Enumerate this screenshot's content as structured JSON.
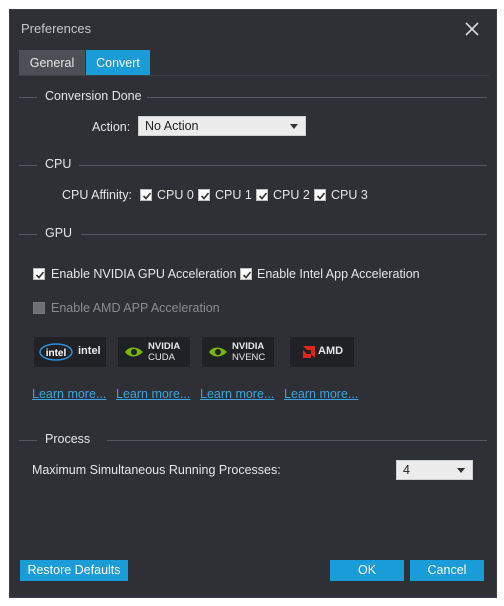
{
  "window": {
    "title": "Preferences"
  },
  "tabs": [
    {
      "label": "General",
      "active": false
    },
    {
      "label": "Convert",
      "active": true
    }
  ],
  "conversion_done": {
    "heading": "Conversion Done",
    "action_label": "Action:",
    "action_value": "No Action"
  },
  "cpu": {
    "heading": "CPU",
    "affinity_label": "CPU Affinity:",
    "cores": [
      {
        "label": "CPU 0",
        "checked": true
      },
      {
        "label": "CPU 1",
        "checked": true
      },
      {
        "label": "CPU 2",
        "checked": true
      },
      {
        "label": "CPU 3",
        "checked": true
      }
    ]
  },
  "gpu": {
    "heading": "GPU",
    "options": [
      {
        "label": "Enable NVIDIA GPU Acceleration",
        "checked": true,
        "enabled": true
      },
      {
        "label": "Enable Intel App Acceleration",
        "checked": true,
        "enabled": true
      },
      {
        "label": "Enable AMD APP Acceleration",
        "checked": false,
        "enabled": false
      }
    ],
    "logos": [
      {
        "icon": "intel-logo-icon",
        "badge": "intel",
        "text": "intel"
      },
      {
        "icon": "nvidia-cuda-logo-icon",
        "line1": "NVIDIA",
        "line2": "CUDA"
      },
      {
        "icon": "nvidia-nvenc-logo-icon",
        "line1": "NVIDIA",
        "line2": "NVENC"
      },
      {
        "icon": "amd-logo-icon",
        "text": "AMD"
      }
    ],
    "links": [
      "Learn more...",
      "Learn more...",
      "Learn more...",
      "Learn more..."
    ]
  },
  "process": {
    "heading": "Process",
    "max_label": "Maximum Simultaneous Running Processes:",
    "max_value": "4"
  },
  "buttons": {
    "restore": "Restore Defaults",
    "ok": "OK",
    "cancel": "Cancel"
  },
  "colors": {
    "accent": "#1a9cd8",
    "background": "#2e3036",
    "nvidia_green": "#76b900",
    "amd_red": "#e0261b",
    "link": "#3aa3e0"
  }
}
